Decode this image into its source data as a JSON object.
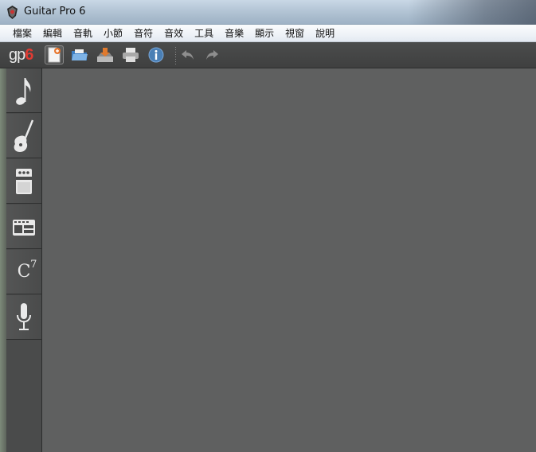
{
  "window": {
    "title": "Guitar Pro 6"
  },
  "menu": {
    "items": [
      "檔案",
      "編輯",
      "音軌",
      "小節",
      "音符",
      "音效",
      "工具",
      "音樂",
      "顯示",
      "視窗",
      "說明"
    ]
  },
  "toolbar": {
    "logo_gp": "gp",
    "logo_six": "6",
    "buttons": [
      "new-file",
      "open-file",
      "save-file",
      "print",
      "info",
      "undo",
      "redo"
    ]
  },
  "sidebar": {
    "panels": [
      "score-notation",
      "instrument",
      "effects-pedal",
      "mixer",
      "chord-diagram",
      "microphone"
    ],
    "chord_label": "C",
    "chord_superscript": "7"
  },
  "colors": {
    "workspace": "#5f6060",
    "toolbar": "#444545",
    "logo_accent": "#e03b33",
    "info_icon": "#4a7fb5"
  }
}
